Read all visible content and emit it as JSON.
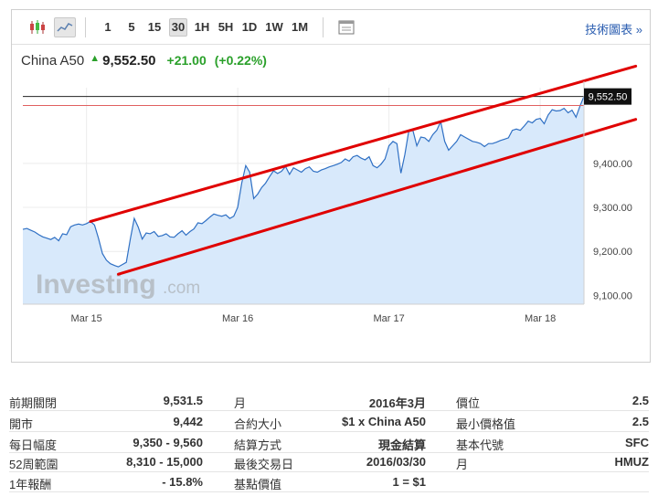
{
  "toolbar": {
    "periods": [
      "1",
      "5",
      "15",
      "30",
      "1H",
      "5H",
      "1D",
      "1W",
      "1M"
    ],
    "active_period": "30",
    "tech_link": "技術圖表 »"
  },
  "quote": {
    "name": "China A50",
    "price": "9,552.50",
    "change": "+21.00",
    "change_pct": "(+0.22%)",
    "up_color": "#2aa02a"
  },
  "chart_data": {
    "type": "area",
    "current_price_label": "9,552.50",
    "y_ticks": [
      "9,400.00",
      "9,300.00",
      "9,200.00",
      "9,100.00"
    ],
    "y_tick_values": [
      9400,
      9300,
      9200,
      9100
    ],
    "ylim": [
      9080,
      9572
    ],
    "x_ticks": [
      "Mar 15",
      "Mar 16",
      "Mar 17",
      "Mar 18"
    ],
    "x_tick_index": [
      16,
      54,
      92,
      130
    ],
    "reference_line": 9531.5,
    "series_color": "#d8e9fb",
    "values": [
      9250,
      9252,
      9248,
      9244,
      9238,
      9233,
      9230,
      9227,
      9232,
      9224,
      9240,
      9238,
      9256,
      9260,
      9262,
      9260,
      9263,
      9268,
      9260,
      9230,
      9195,
      9180,
      9172,
      9168,
      9165,
      9170,
      9175,
      9228,
      9275,
      9255,
      9228,
      9242,
      9240,
      9245,
      9234,
      9236,
      9240,
      9233,
      9232,
      9240,
      9247,
      9237,
      9245,
      9251,
      9265,
      9263,
      9270,
      9278,
      9285,
      9282,
      9280,
      9283,
      9275,
      9280,
      9300,
      9355,
      9395,
      9380,
      9320,
      9330,
      9345,
      9355,
      9370,
      9383,
      9377,
      9382,
      9393,
      9375,
      9390,
      9385,
      9380,
      9388,
      9392,
      9382,
      9380,
      9385,
      9388,
      9392,
      9395,
      9398,
      9402,
      9410,
      9405,
      9415,
      9418,
      9412,
      9408,
      9415,
      9395,
      9390,
      9398,
      9410,
      9440,
      9450,
      9445,
      9378,
      9420,
      9475,
      9475,
      9440,
      9460,
      9458,
      9450,
      9465,
      9475,
      9495,
      9450,
      9430,
      9440,
      9450,
      9465,
      9460,
      9455,
      9450,
      9448,
      9445,
      9438,
      9445,
      9445,
      9448,
      9452,
      9455,
      9458,
      9475,
      9478,
      9475,
      9485,
      9496,
      9492,
      9500,
      9502,
      9490,
      9510,
      9522,
      9519,
      9520,
      9525,
      9515,
      9521,
      9505,
      9530,
      9552
    ]
  },
  "trendlines": {
    "color": "#e00000",
    "upper": {
      "from": [
        17,
        9268
      ],
      "to": [
        154,
        9621
      ]
    },
    "lower": {
      "from": [
        24,
        9148
      ],
      "to": [
        154,
        9500
      ]
    }
  },
  "logo": "Investing.com",
  "stats": [
    {
      "l1": "前期關閉",
      "v1": "9,531.5",
      "l2": "月",
      "v2": "2016年3月",
      "l3": "價位",
      "v3": "2.5"
    },
    {
      "l1": "開市",
      "v1": "9,442",
      "l2": "合約大小",
      "v2": "$1 x China A50",
      "l3": "最小價格值",
      "v3": "2.5"
    },
    {
      "l1": "每日幅度",
      "v1": "9,350 - 9,560",
      "l2": "結算方式",
      "v2": "現金結算",
      "l3": "基本代號",
      "v3": "SFC"
    },
    {
      "l1": "52周範圍",
      "v1": "8,310 - 15,000",
      "l2": "最後交易日",
      "v2": "2016/03/30",
      "l3": "月",
      "v3": "HMUZ"
    },
    {
      "l1": "1年報酬",
      "v1": "- 15.8%",
      "l2": "基點價值",
      "v2": "1 = $1",
      "l3": "",
      "v3": ""
    }
  ]
}
